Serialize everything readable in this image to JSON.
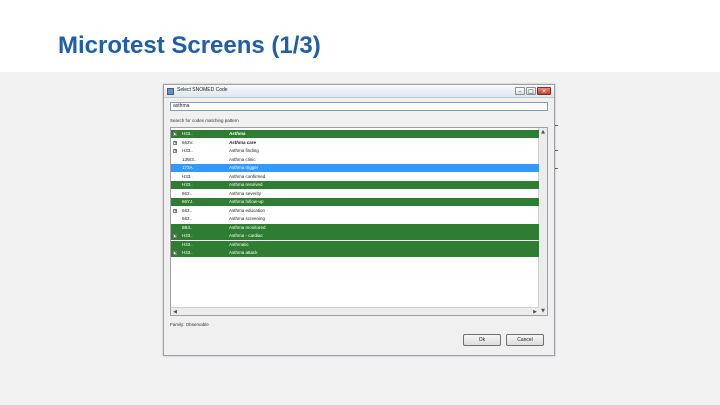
{
  "slide": {
    "title": "Microtest Screens (1/3)"
  },
  "dialog": {
    "title": "Select SNOMED Code",
    "window_buttons": {
      "minimize": "–",
      "maximize": "□",
      "close": "×"
    },
    "search_value": "asthma",
    "search_caption": "Search for codes matching pattern",
    "tree": [
      {
        "code": "H33..",
        "desc": "Asthma",
        "style": "green",
        "bold": true,
        "expander": "+"
      },
      {
        "code": "663V..",
        "desc": "Asthma care",
        "style": "white",
        "bold": true,
        "expander": "+"
      },
      {
        "code": "H33..",
        "desc": "Asthma finding",
        "style": "white",
        "bold": false,
        "expander": "+"
      },
      {
        "code": "13W3..",
        "desc": "Asthma clinic",
        "style": "white",
        "bold": false,
        "expander": ""
      },
      {
        "code": "173A.",
        "desc": "Asthma trigger",
        "style": "blue",
        "bold": false,
        "expander": ""
      },
      {
        "code": "H33..",
        "desc": "Asthma confirmed",
        "style": "white",
        "bold": false,
        "expander": ""
      },
      {
        "code": "H33..",
        "desc": "Asthma resolved",
        "style": "green",
        "bold": false,
        "expander": ""
      },
      {
        "code": "663..",
        "desc": "Asthma severity",
        "style": "white",
        "bold": false,
        "expander": ""
      },
      {
        "code": "66YJ..",
        "desc": "Asthma follow-up",
        "style": "green",
        "bold": false,
        "expander": ""
      },
      {
        "code": "663..",
        "desc": "Asthma education",
        "style": "white",
        "bold": false,
        "expander": "+"
      },
      {
        "code": "663..",
        "desc": "Asthma screening",
        "style": "white",
        "bold": false,
        "expander": ""
      },
      {
        "code": "8B3..",
        "desc": "Asthma monitored",
        "style": "green",
        "bold": false,
        "expander": ""
      },
      {
        "code": "H33..",
        "desc": "Asthma - cardiac",
        "style": "green",
        "bold": false,
        "expander": "+"
      },
      {
        "code": "H33..",
        "desc": "Asthmatic",
        "style": "green",
        "bold": false,
        "expander": ""
      },
      {
        "code": "H33..",
        "desc": "Asthma attack",
        "style": "green",
        "bold": false,
        "expander": "+"
      }
    ],
    "scroll_arrows": {
      "up": "▲",
      "down": "▼",
      "left": "◀",
      "right": "▶"
    },
    "status": "Family: Observable",
    "ok_label": "Ok",
    "cancel_label": "Cancel"
  },
  "colors": {
    "green_row": "#2e7d32",
    "selected_row": "#3399ff",
    "title_blue": "#1e5fa8"
  }
}
